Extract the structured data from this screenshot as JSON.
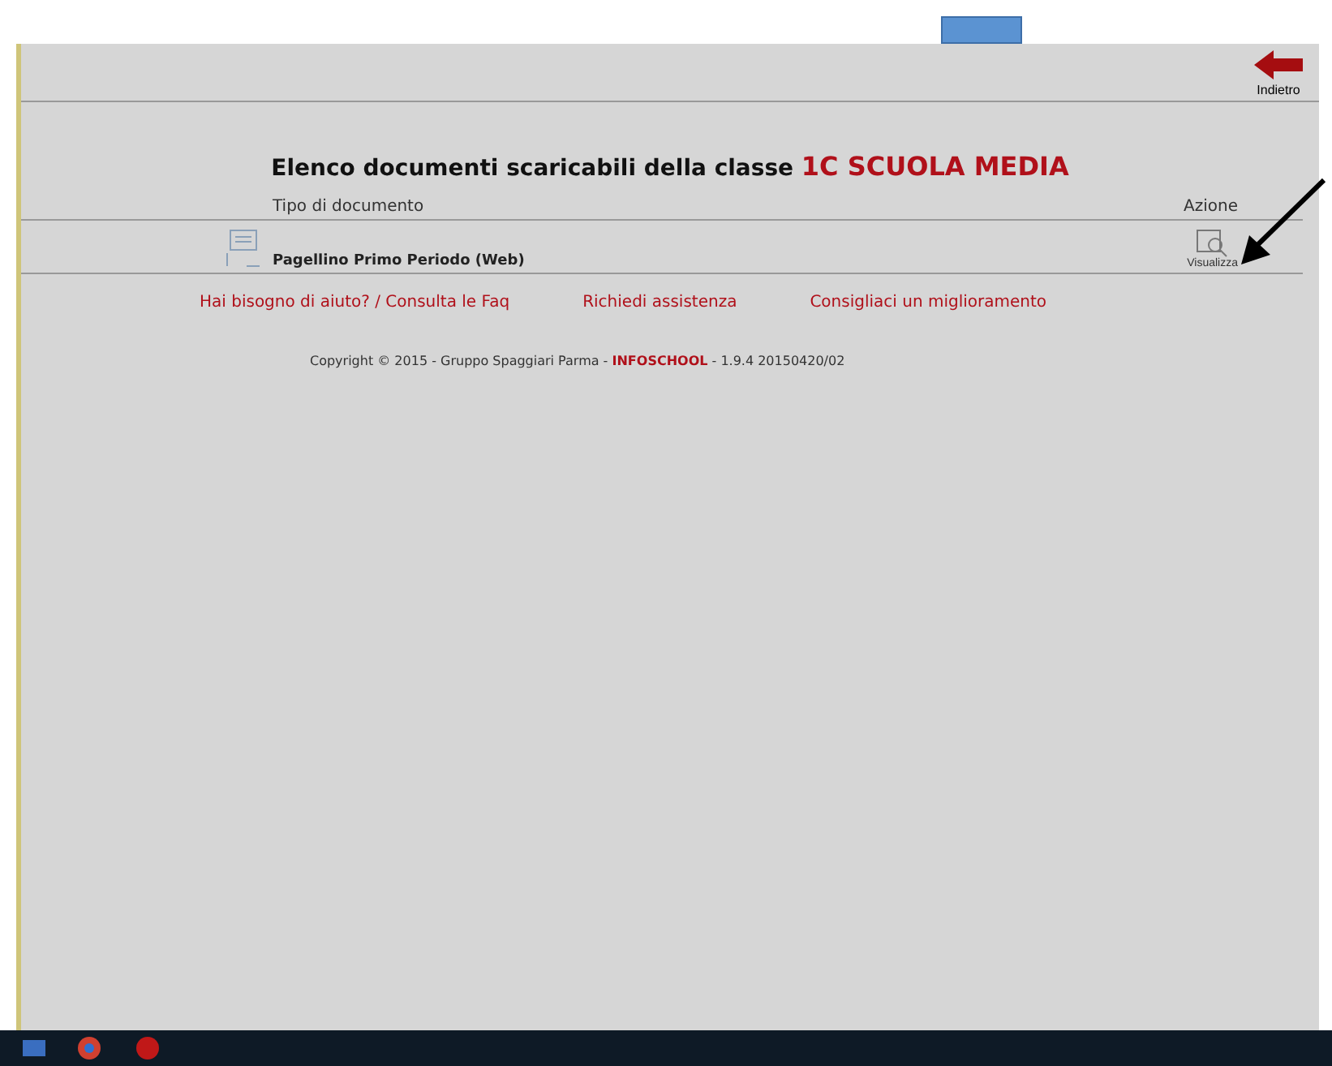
{
  "back_button": {
    "label": "Indietro"
  },
  "title": {
    "text": "Elenco documenti scaricabili della classe ",
    "class_name": "1C SCUOLA MEDIA"
  },
  "table": {
    "columns": [
      "Tipo di documento",
      "Azione"
    ],
    "rows": [
      {
        "document": "Pagellino Primo Periodo (Web)",
        "action": "Visualizza"
      }
    ]
  },
  "links": [
    "Hai bisogno di aiuto? / Consulta le Faq",
    "Richiedi assistenza",
    "Consigliaci un miglioramento"
  ],
  "footer": {
    "prefix": "Copyright © 2015 - Gruppo Spaggiari Parma - ",
    "brand": "INFOSCHOOL",
    "suffix": " - 1.9.4 20150420/02"
  }
}
